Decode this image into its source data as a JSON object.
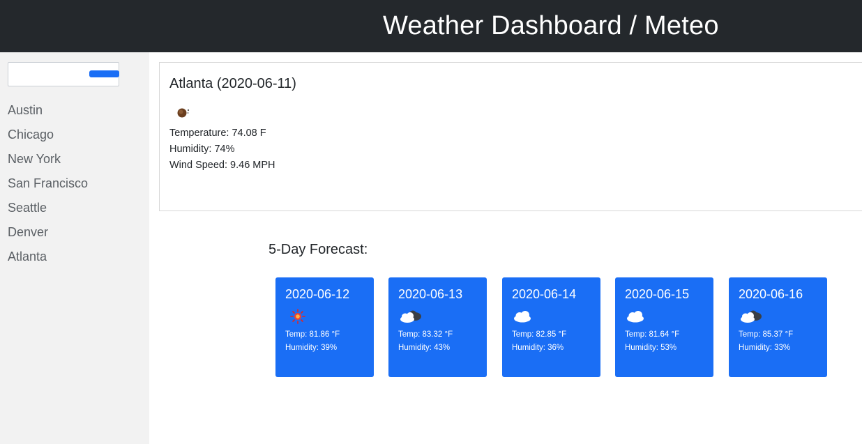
{
  "header": {
    "title": "Weather Dashboard / Meteo"
  },
  "sidebar": {
    "search": {
      "value": "",
      "placeholder": ""
    },
    "cities": [
      "Austin",
      "Chicago",
      "New York",
      "San Francisco",
      "Seattle",
      "Denver",
      "Atlanta"
    ]
  },
  "current": {
    "title": "Atlanta (2020-06-11)",
    "icon": "moon-night-icon",
    "temperature": "Temperature: 74.08 F",
    "humidity": "Humidity: 74%",
    "wind_speed": "Wind Speed: 9.46 MPH"
  },
  "forecast": {
    "heading": "5-Day Forecast:",
    "days": [
      {
        "date": "2020-06-12",
        "icon": "sun-icon",
        "temp": "Temp: 81.86 °F",
        "humidity": "Humidity: 39%"
      },
      {
        "date": "2020-06-13",
        "icon": "partly-cloudy-icon",
        "temp": "Temp: 83.32 °F",
        "humidity": "Humidity: 43%"
      },
      {
        "date": "2020-06-14",
        "icon": "cloud-icon",
        "temp": "Temp: 82.85 °F",
        "humidity": "Humidity: 36%"
      },
      {
        "date": "2020-06-15",
        "icon": "cloud-icon",
        "temp": "Temp: 81.64 °F",
        "humidity": "Humidity: 53%"
      },
      {
        "date": "2020-06-16",
        "icon": "partly-cloudy-icon",
        "temp": "Temp: 85.37 °F",
        "humidity": "Humidity: 33%"
      }
    ]
  },
  "colors": {
    "header_bg": "#24282c",
    "sidebar_bg": "#f2f2f2",
    "accent": "#1a6ef5"
  }
}
